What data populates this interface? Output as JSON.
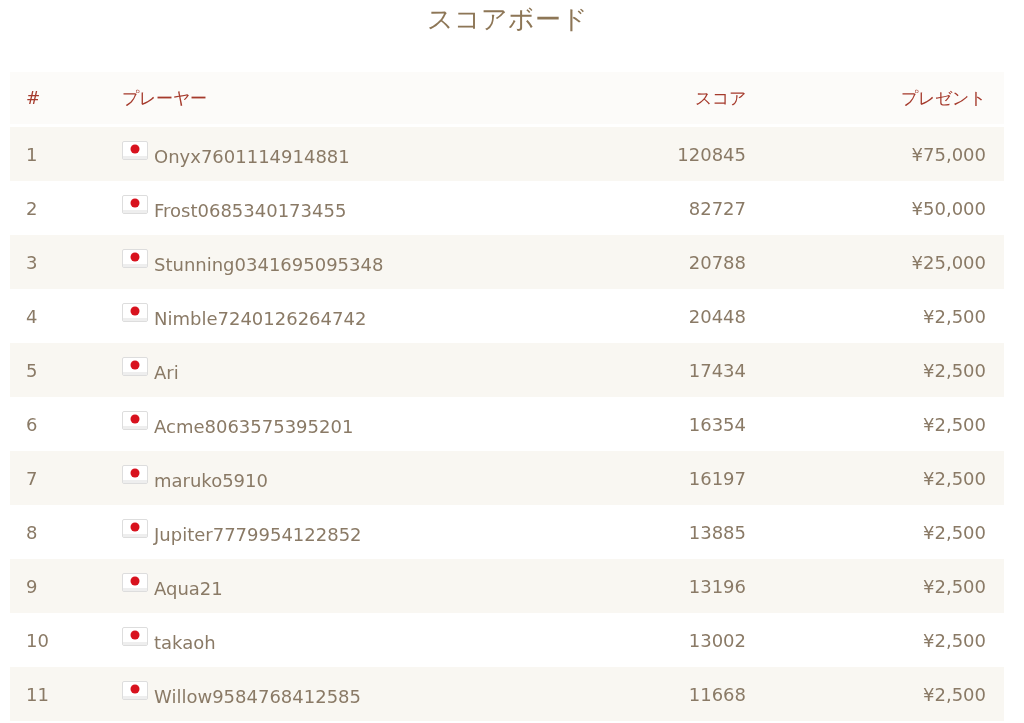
{
  "title": "スコアボード",
  "table": {
    "columns": [
      "#",
      "プレーヤー",
      "スコア",
      "プレゼント"
    ],
    "rows": [
      {
        "rank": "1",
        "player": "Onyx7601114914881",
        "score": "120845",
        "prize": "¥75,000"
      },
      {
        "rank": "2",
        "player": "Frost0685340173455",
        "score": "82727",
        "prize": "¥50,000"
      },
      {
        "rank": "3",
        "player": "Stunning0341695095348",
        "score": "20788",
        "prize": "¥25,000"
      },
      {
        "rank": "4",
        "player": "Nimble7240126264742",
        "score": "20448",
        "prize": "¥2,500"
      },
      {
        "rank": "5",
        "player": "Ari",
        "score": "17434",
        "prize": "¥2,500"
      },
      {
        "rank": "6",
        "player": "Acme8063575395201",
        "score": "16354",
        "prize": "¥2,500"
      },
      {
        "rank": "7",
        "player": "maruko5910",
        "score": "16197",
        "prize": "¥2,500"
      },
      {
        "rank": "8",
        "player": "Jupiter7779954122852",
        "score": "13885",
        "prize": "¥2,500"
      },
      {
        "rank": "9",
        "player": "Aqua21",
        "score": "13196",
        "prize": "¥2,500"
      },
      {
        "rank": "10",
        "player": "takaoh",
        "score": "13002",
        "prize": "¥2,500"
      },
      {
        "rank": "11",
        "player": "Willow9584768412585",
        "score": "11668",
        "prize": "¥2,500"
      }
    ]
  }
}
